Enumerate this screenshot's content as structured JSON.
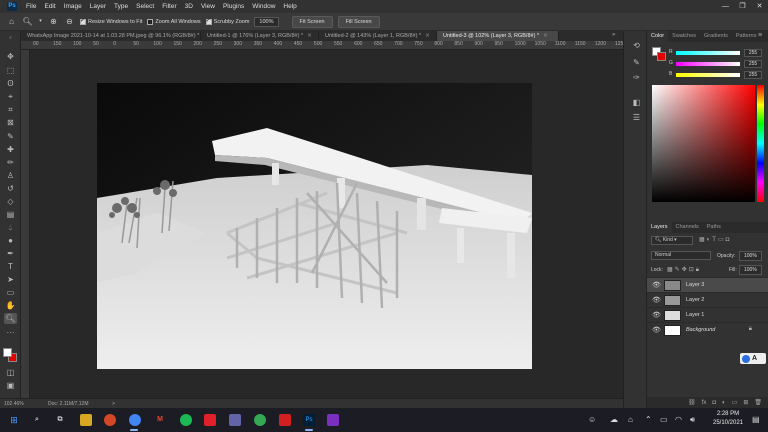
{
  "app": {
    "logo": "Ps",
    "menu": [
      "File",
      "Edit",
      "Image",
      "Layer",
      "Type",
      "Select",
      "Filter",
      "3D",
      "View",
      "Plugins",
      "Window",
      "Help"
    ],
    "window_controls": [
      "—",
      "❐",
      "✕"
    ]
  },
  "options": {
    "resize_windows_label": "Resize Windows to Fit",
    "zoom_all_label": "Zoom All Windows",
    "scrubby_zoom_label": "Scrubby Zoom",
    "zoom_value": "100%",
    "fit_screen_label": "Fit Screen",
    "fill_screen_label": "Fill Screen"
  },
  "tabs": [
    {
      "label": "WhatsApp Image 2021-10-14 at 1.03.28 PM.jpeg @ 96.1% (RGB/8#) *",
      "active": false
    },
    {
      "label": "Untitled-1 @ 176% (Layer 3, RGB/8#) *",
      "active": false
    },
    {
      "label": "Untitled-2 @ 143% (Layer 1, RGB/8#) *",
      "active": false
    },
    {
      "label": "Untitled-3 @ 102% (Layer 3, RGB/8#) *",
      "active": true
    }
  ],
  "tab_overflow": "»",
  "ruler": {
    "labels": [
      "00",
      "150",
      "100",
      "50",
      "0",
      "50",
      "100",
      "150",
      "200",
      "250",
      "300",
      "350",
      "400",
      "450",
      "500",
      "550",
      "600",
      "650",
      "700",
      "750",
      "800",
      "850",
      "900",
      "950",
      "1000",
      "1050",
      "1100",
      "1150",
      "1200",
      "1250"
    ]
  },
  "status": {
    "zoom": "102.46%",
    "doc": "Doc: 2.11M/7.12M",
    "arrow": ">"
  },
  "color_panel": {
    "tabs": [
      "Color",
      "Swatches",
      "Gradients",
      "Patterns"
    ],
    "active_tab": "Color",
    "channels": [
      {
        "label": "R",
        "value": "255",
        "gradient": "#00ffff"
      },
      {
        "label": "G",
        "value": "255",
        "gradient": "#ff00ff"
      },
      {
        "label": "B",
        "value": "255",
        "gradient": "#ffff00"
      }
    ],
    "foreground": "#ffffff",
    "background": "#e00000"
  },
  "layers_panel": {
    "tabs": [
      "Layers",
      "Channels",
      "Paths"
    ],
    "active_tab": "Layers",
    "filter_label": "Kind",
    "blend_mode": "Normal",
    "opacity_label": "Opacity:",
    "opacity_value": "100%",
    "lock_label": "Lock:",
    "fill_label": "Fill:",
    "fill_value": "100%",
    "layers": [
      {
        "name": "Layer 3",
        "selected": true,
        "locked": false
      },
      {
        "name": "Layer 2",
        "selected": false,
        "locked": false
      },
      {
        "name": "Layer 1",
        "selected": false,
        "locked": false
      },
      {
        "name": "Background",
        "selected": false,
        "locked": true
      }
    ],
    "footer_icons": [
      "link-icon",
      "fx-icon",
      "mask-icon",
      "adjustment-icon",
      "group-icon",
      "new-layer-icon",
      "trash-icon"
    ],
    "footer_glyphs": [
      "⛓",
      "fx",
      "◘",
      "◐",
      "▭",
      "⊞",
      "🗑"
    ]
  },
  "taskbar": {
    "clock_time": "2:28 PM",
    "clock_date": "25/10/2021",
    "ime_label": "A"
  }
}
